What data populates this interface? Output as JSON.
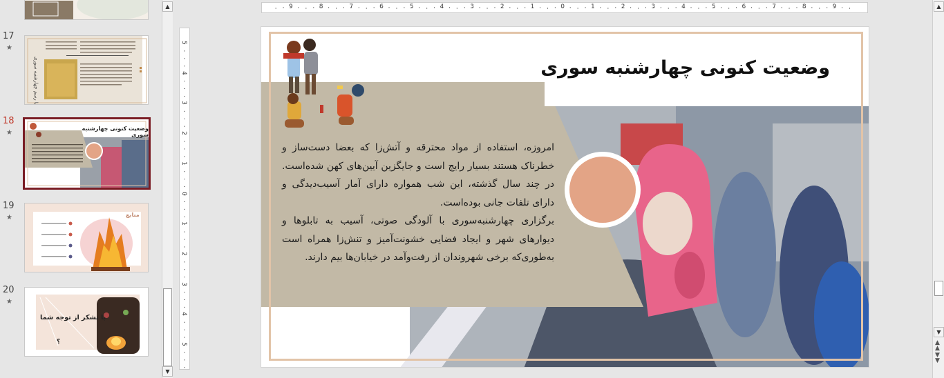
{
  "thumbnails": {
    "items": [
      {
        "number": "17",
        "star": "★",
        "title_vertical": "آشنایی با رسم چهارشنبه سوری"
      },
      {
        "number": "18",
        "star": "★",
        "title": "وضعیت کنونی چهارشنبه سوری"
      },
      {
        "number": "19",
        "star": "★",
        "title": "منابع"
      },
      {
        "number": "20",
        "star": "★",
        "title": "با تشکر از توجه شما",
        "q": "؟"
      }
    ]
  },
  "ruler": {
    "horizontal": [
      "9",
      "8",
      "7",
      "6",
      "5",
      "4",
      "3",
      "2",
      "1",
      "0",
      "1",
      "2",
      "3",
      "4",
      "5",
      "6",
      "7",
      "8",
      "9"
    ],
    "vertical": [
      "5",
      "4",
      "3",
      "2",
      "1",
      "0",
      "1",
      "2",
      "3",
      "4",
      "5"
    ]
  },
  "slide": {
    "title": "وضعیت کنونی چهارشنبه سوری",
    "paragraphs": [
      "امروزه، استفاده از مواد محترقه و آتش‌زا که بعضا دست‌ساز و خطرناک هستند بسیار رایج است و جایگزین آیین‌های کهن شده‌است. در چند سال گذشته، این شب همواره دارای آمار آسیب‌دیدگی و دارای تلفات جانی بوده‌است.",
      "برگزاری چهارشنبه‌سوری با آلودگی صوتی، آسیب به تابلوها و دیوارهای شهر و ایجاد فضایی خشونت‌آمیز و تنش‌زا همراه است به‌طوری‌که برخی شهروندان از رفت‌وآمد در خیابان‌ها بیم دارند."
    ]
  },
  "colors": {
    "beige_panel": "#c2b9a6",
    "frame": "#e2c4a8",
    "circle": "#e3a486",
    "selected_border": "#7a1c24",
    "slide_number_active": "#c0392b"
  }
}
